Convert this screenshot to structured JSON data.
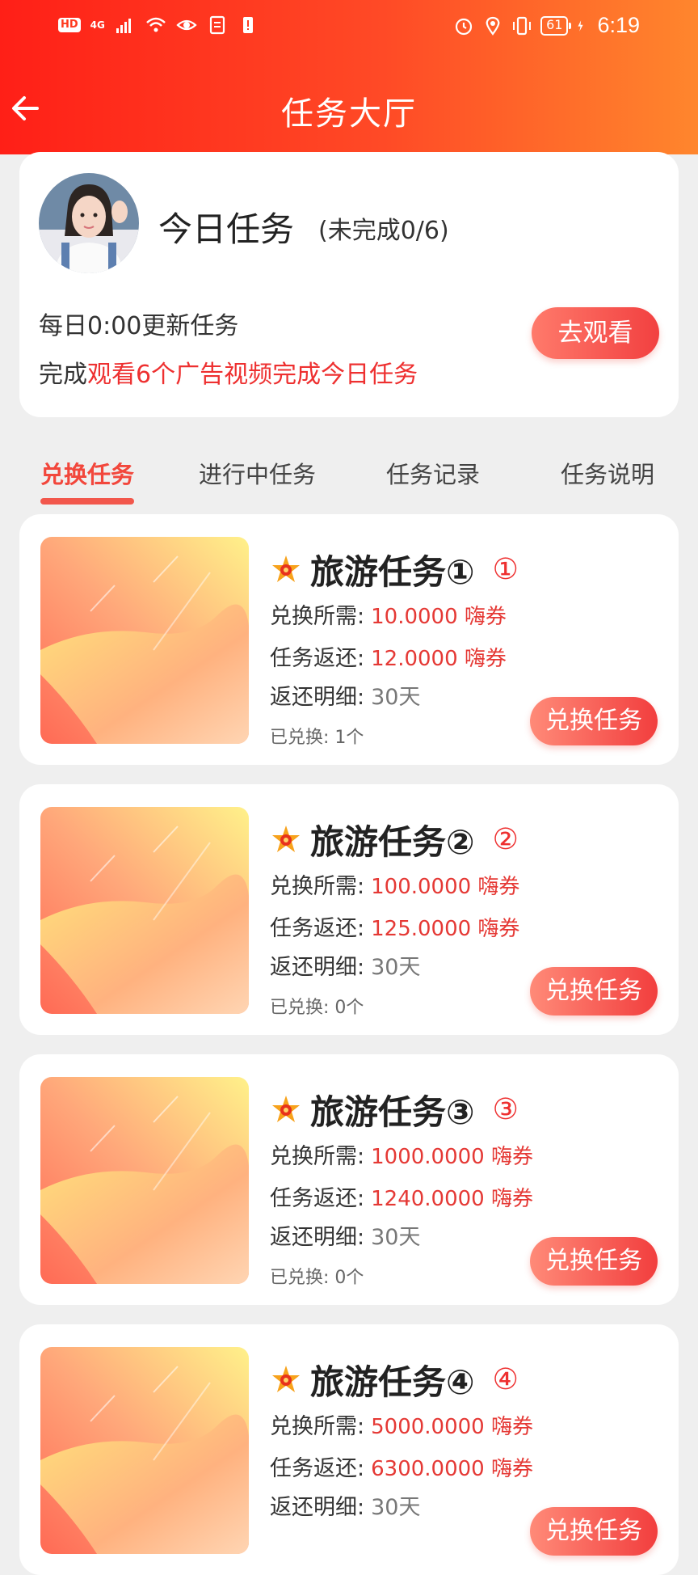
{
  "status_bar": {
    "hd": "HD",
    "network": "4G",
    "battery": "61",
    "time": "6:19"
  },
  "nav": {
    "title": "任务大厅"
  },
  "today": {
    "title": "今日任务",
    "status": "(未完成0/6)",
    "update_text": "每日0:00更新任务",
    "complete_prefix": "完成",
    "complete_highlight": "观看6个广告视频完成今日任务",
    "watch_button": "去观看"
  },
  "tabs": [
    {
      "label": "兑换任务",
      "active": true
    },
    {
      "label": "进行中任务",
      "active": false
    },
    {
      "label": "任务记录",
      "active": false
    },
    {
      "label": "任务说明",
      "active": false
    }
  ],
  "labels": {
    "cost": "兑换所需:",
    "return": "任务返还:",
    "detail": "返还明细:",
    "exchange_button": "兑换任务"
  },
  "tasks": [
    {
      "name": "旅游任务①",
      "num": "①",
      "cost": "10.0000 嗨券",
      "return": "12.0000 嗨券",
      "detail": "30天",
      "exchanged": "已兑换: 1个"
    },
    {
      "name": "旅游任务②",
      "num": "②",
      "cost": "100.0000 嗨券",
      "return": "125.0000 嗨券",
      "detail": "30天",
      "exchanged": "已兑换: 0个"
    },
    {
      "name": "旅游任务③",
      "num": "③",
      "cost": "1000.0000 嗨券",
      "return": "1240.0000 嗨券",
      "detail": "30天",
      "exchanged": "已兑换: 0个"
    },
    {
      "name": "旅游任务④",
      "num": "④",
      "cost": "5000.0000 嗨券",
      "return": "6300.0000 嗨券",
      "detail": "30天",
      "exchanged": ""
    }
  ],
  "colors": {
    "header_start": "#ff1f17",
    "header_end": "#ff862d",
    "accent": "#ee3030",
    "button": "#f24040"
  }
}
